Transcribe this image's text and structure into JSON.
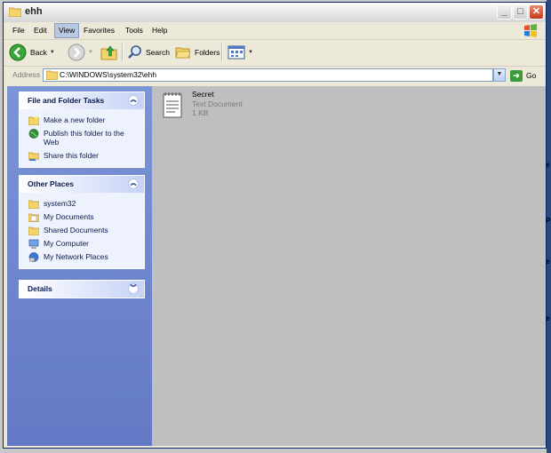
{
  "window": {
    "title": "ehh",
    "controls": {
      "minimize": "_",
      "maximize": "□",
      "close": "✕"
    }
  },
  "menubar": {
    "items": [
      "File",
      "Edit",
      "View",
      "Favorites",
      "Tools",
      "Help"
    ],
    "active": "View"
  },
  "toolbar": {
    "back_label": "Back",
    "search_label": "Search",
    "folders_label": "Folders"
  },
  "address": {
    "label": "Address",
    "value": "C:\\WINDOWS\\system32\\ehh",
    "go_label": "Go"
  },
  "taskpane": {
    "file_tasks": {
      "title": "File and Folder Tasks",
      "items": [
        {
          "label": "Make a new folder",
          "icon": "new-folder-icon"
        },
        {
          "label": "Publish this folder to the Web",
          "icon": "globe-icon"
        },
        {
          "label": "Share this folder",
          "icon": "share-folder-icon"
        }
      ]
    },
    "other_places": {
      "title": "Other Places",
      "items": [
        {
          "label": "system32",
          "icon": "folder-icon"
        },
        {
          "label": "My Documents",
          "icon": "my-documents-icon"
        },
        {
          "label": "Shared Documents",
          "icon": "folder-icon"
        },
        {
          "label": "My Computer",
          "icon": "my-computer-icon"
        },
        {
          "label": "My Network Places",
          "icon": "network-icon"
        }
      ]
    },
    "details": {
      "title": "Details"
    }
  },
  "files": [
    {
      "name": "Secret",
      "type": "Text Document",
      "size": "1 KB",
      "icon": "text-document-icon"
    }
  ],
  "colors": {
    "taskpane_bg": "#7b94d6",
    "content_bg": "#bfbfbf",
    "close_button": "#c33b1b"
  }
}
